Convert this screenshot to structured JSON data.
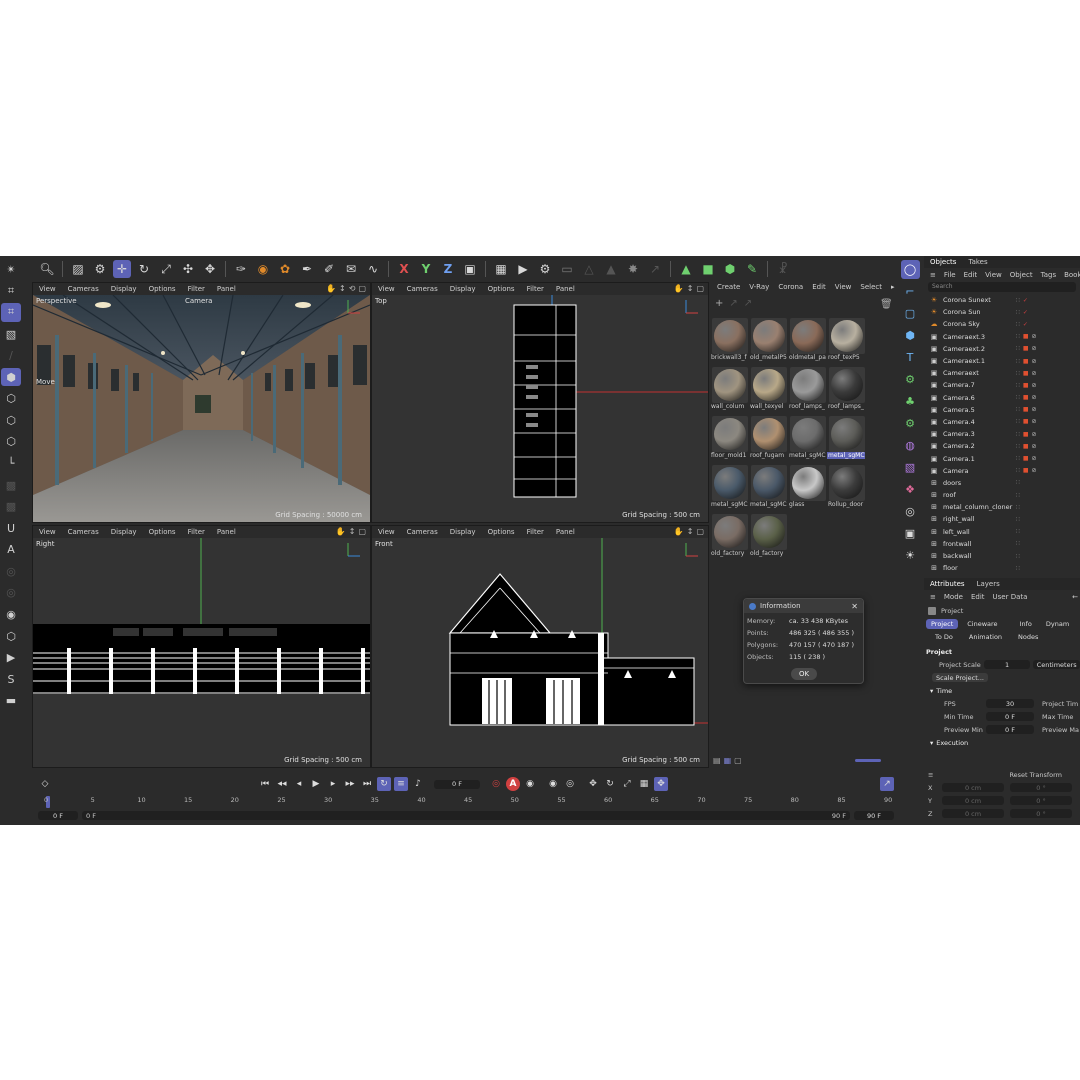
{
  "viewports": {
    "menu": [
      "View",
      "Cameras",
      "Display",
      "Options",
      "Filter",
      "Panel"
    ],
    "perspective": {
      "label": "Perspective",
      "camera": "Camera",
      "mode": "Move",
      "grid": "Grid Spacing : 50000 cm"
    },
    "top": {
      "label": "Top",
      "grid": "Grid Spacing : 500 cm"
    },
    "right": {
      "label": "Right",
      "grid": "Grid Spacing : 500 cm"
    },
    "front": {
      "label": "Front",
      "grid": "Grid Spacing : 500 cm"
    }
  },
  "materials": {
    "menu": [
      "Create",
      "V-Ray",
      "Corona",
      "Edit",
      "View",
      "Select"
    ],
    "items": [
      {
        "name": "brickwall3_f",
        "color": "#8a7060"
      },
      {
        "name": "old_metalP5",
        "color": "#9a8070"
      },
      {
        "name": "oldmetal_pa",
        "color": "#8a6a58"
      },
      {
        "name": "roof_texP5",
        "color": "#b8b0a0"
      },
      {
        "name": "wall_colum",
        "color": "#a09480"
      },
      {
        "name": "wall_texyel",
        "color": "#b8a888"
      },
      {
        "name": "roof_lamps_",
        "color": "#9a9a9a"
      },
      {
        "name": "roof_lamps_",
        "color": "#3a3a3a"
      },
      {
        "name": "floor_mold1",
        "color": "#8c8880"
      },
      {
        "name": "roof_fugam",
        "color": "#b09070"
      },
      {
        "name": "metal_sgMC",
        "color": "#6c6c6c"
      },
      {
        "name": "metal_sgMC",
        "color": "#5c5c58",
        "selected": true
      },
      {
        "name": "metal_sgMC",
        "color": "#4a5a6a"
      },
      {
        "name": "metal_sgMC",
        "color": "#4a5868"
      },
      {
        "name": "glass",
        "color": "#c8c8c8"
      },
      {
        "name": "Rollup_door",
        "color": "#3c3c3c"
      },
      {
        "name": "old_factory",
        "color": "#7a6c64"
      },
      {
        "name": "old_factory",
        "color": "#5a6048"
      }
    ]
  },
  "info_dialog": {
    "title": "Information",
    "rows": [
      {
        "key": "Memory:",
        "value": "ca. 33 438 KBytes"
      },
      {
        "key": "Points:",
        "value": "486 325 ( 486 355 )"
      },
      {
        "key": "Polygons:",
        "value": "470 157 ( 470 187 )"
      },
      {
        "key": "Objects:",
        "value": "115 ( 238 )"
      }
    ],
    "ok": "OK"
  },
  "objects": {
    "tabs": [
      "Objects",
      "Takes"
    ],
    "menu": [
      "File",
      "Edit",
      "View",
      "Object",
      "Tags",
      "Bookmar"
    ],
    "search_placeholder": "Search",
    "items": [
      {
        "name": "Corona Sunext",
        "icon": "sun-icon",
        "color": "#e08a2a"
      },
      {
        "name": "Corona Sun",
        "icon": "sun-icon",
        "color": "#e08a2a"
      },
      {
        "name": "Corona Sky",
        "icon": "sky-icon",
        "color": "#e08a2a"
      },
      {
        "name": "Cameraext.3",
        "icon": "camera-icon",
        "color": "#cfcfcf"
      },
      {
        "name": "Cameraext.2",
        "icon": "camera-icon",
        "color": "#cfcfcf"
      },
      {
        "name": "Cameraext.1",
        "icon": "camera-icon",
        "color": "#cfcfcf"
      },
      {
        "name": "Cameraext",
        "icon": "camera-icon",
        "color": "#cfcfcf"
      },
      {
        "name": "Camera.7",
        "icon": "camera-icon",
        "color": "#cfcfcf"
      },
      {
        "name": "Camera.6",
        "icon": "camera-icon",
        "color": "#cfcfcf"
      },
      {
        "name": "Camera.5",
        "icon": "camera-icon",
        "color": "#cfcfcf"
      },
      {
        "name": "Camera.4",
        "icon": "camera-icon",
        "color": "#cfcfcf"
      },
      {
        "name": "Camera.3",
        "icon": "camera-icon",
        "color": "#cfcfcf"
      },
      {
        "name": "Camera.2",
        "icon": "camera-icon",
        "color": "#cfcfcf"
      },
      {
        "name": "Camera.1",
        "icon": "camera-icon",
        "color": "#cfcfcf"
      },
      {
        "name": "Camera",
        "icon": "camera-icon",
        "color": "#cfcfcf"
      },
      {
        "name": "doors",
        "icon": "null-icon",
        "color": "#cfcfcf"
      },
      {
        "name": "roof",
        "icon": "null-icon",
        "color": "#cfcfcf"
      },
      {
        "name": "metal_column_cloner",
        "icon": "cloner-icon",
        "color": "#cfcfcf"
      },
      {
        "name": "right_wall",
        "icon": "null-icon",
        "color": "#cfcfcf"
      },
      {
        "name": "left_wall",
        "icon": "null-icon",
        "color": "#cfcfcf"
      },
      {
        "name": "frontwall",
        "icon": "null-icon",
        "color": "#cfcfcf"
      },
      {
        "name": "backwall",
        "icon": "null-icon",
        "color": "#cfcfcf"
      },
      {
        "name": "floor",
        "icon": "null-icon",
        "color": "#cfcfcf"
      }
    ]
  },
  "attributes": {
    "tabs": [
      "Attributes",
      "Layers"
    ],
    "menu": [
      "Mode",
      "Edit",
      "User Data"
    ],
    "object": "Project",
    "subtabs": [
      "Project",
      "Cineware",
      "Info",
      "Dynam"
    ],
    "subtabs2": [
      "To Do",
      "Animation",
      "Nodes"
    ],
    "section": "Project",
    "project_scale_label": "Project Scale",
    "project_scale_value": "1",
    "project_scale_unit": "Centimeters",
    "scale_button": "Scale Project...",
    "time_section": "Time",
    "fps_label": "FPS",
    "fps_value": "30",
    "project_time_label": "Project Tim",
    "min_time_label": "Min Time",
    "min_time_value": "0 F",
    "max_time_label": "Max Time",
    "preview_min_label": "Preview Min",
    "preview_min_value": "0 F",
    "preview_max_label": "Preview Ma",
    "execution_section": "Execution"
  },
  "coords": {
    "reset": "Reset Transform",
    "rows": [
      {
        "axis": "X",
        "pos": "0 cm",
        "rot": "0 °"
      },
      {
        "axis": "Y",
        "pos": "0 cm",
        "rot": "0 °"
      },
      {
        "axis": "Z",
        "pos": "0 cm",
        "rot": "0 °"
      }
    ]
  },
  "timeline": {
    "current_frame": "0 F",
    "ticks": [
      "0",
      "5",
      "10",
      "15",
      "20",
      "25",
      "30",
      "35",
      "40",
      "45",
      "50",
      "55",
      "60",
      "65",
      "70",
      "75",
      "80",
      "85",
      "90"
    ],
    "range_start": "0 F",
    "range_start2": "0 F",
    "range_end": "90 F",
    "range_end2": "90 F"
  }
}
